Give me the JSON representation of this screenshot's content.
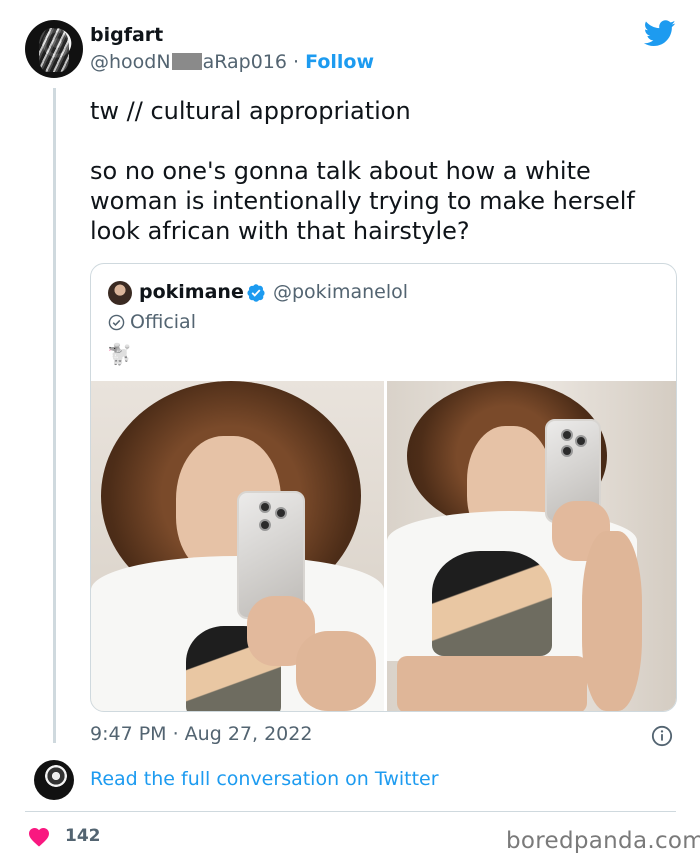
{
  "author": {
    "name": "bigfart",
    "handle_start": "@hoodN",
    "handle_end": "aRap016",
    "separator": "·",
    "follow_label": "Follow"
  },
  "tweet": {
    "line1": "tw // cultural appropriation",
    "line2": "so no one's gonna talk about how a white woman is intentionally trying to make herself look african with that hairstyle?"
  },
  "quote": {
    "name": "pokimane",
    "handle": "@pokimanelol",
    "badge_label": "Official",
    "emoji": "🐩"
  },
  "timestamp": "9:47 PM · Aug 27, 2022",
  "read_link": "Read the full conversation on Twitter",
  "likes": "142",
  "watermark": "boredpanda.com",
  "colors": {
    "link_blue": "#1d9bf0",
    "verified_blue": "#1d9bf0",
    "heart_pink": "#f91880",
    "secondary_text": "#536471",
    "border": "#cfd9de"
  },
  "icons": [
    "twitter-bird-icon",
    "verified-icon",
    "official-badge-icon",
    "info-icon",
    "heart-icon"
  ]
}
